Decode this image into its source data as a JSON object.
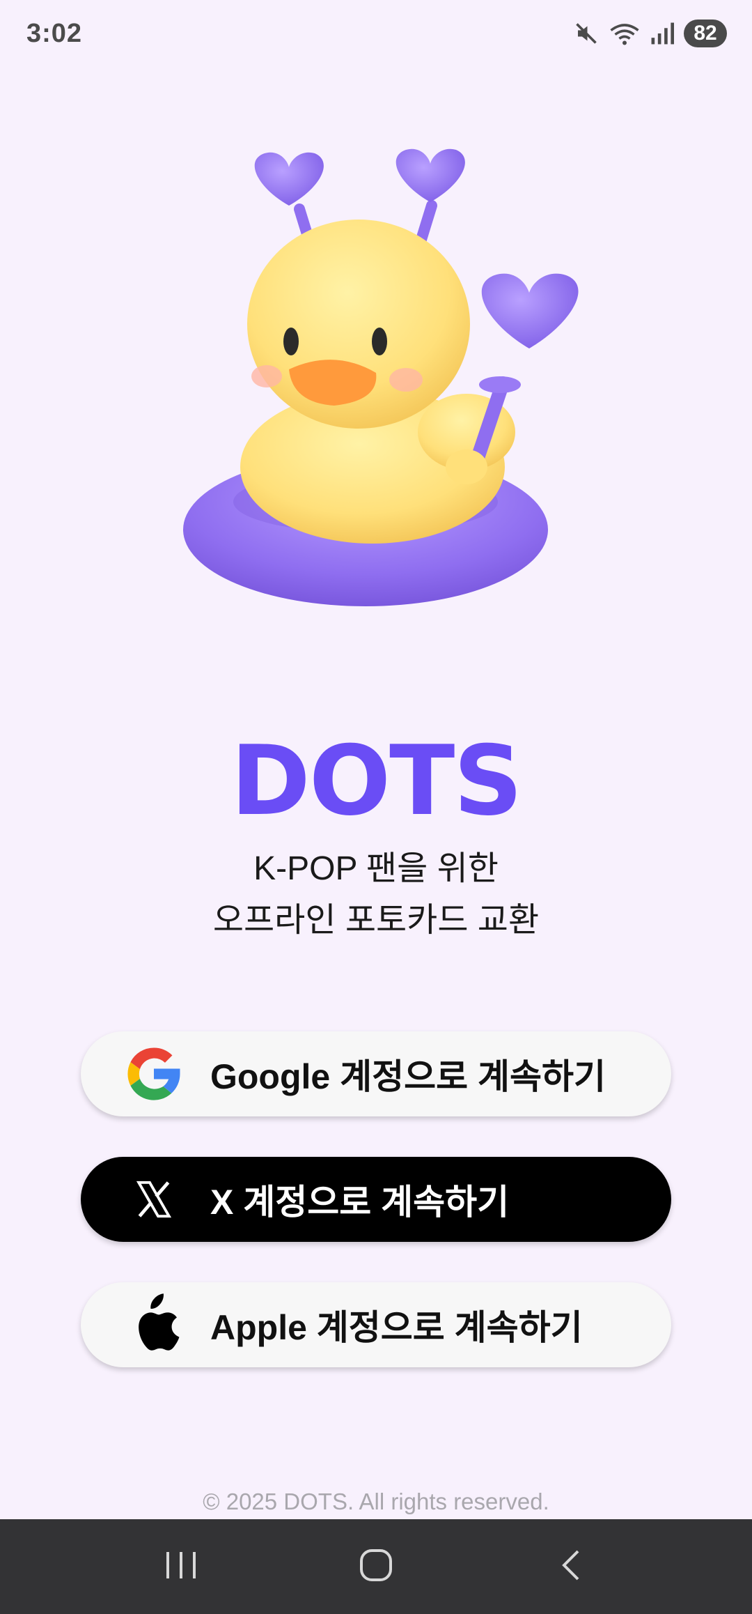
{
  "status_bar": {
    "time": "3:02",
    "battery": "82",
    "icons": [
      "mute-icon",
      "wifi-icon",
      "signal-icon"
    ]
  },
  "brand": {
    "name": "DOTS",
    "color": "#6a4df5",
    "tagline_line1": "K-POP 팬을 위한",
    "tagline_line2": "오프라인 포토카드 교환"
  },
  "login": {
    "google_label": "Google 계정으로 계속하기",
    "x_label": "X 계정으로 계속하기",
    "apple_label": "Apple 계정으로 계속하기"
  },
  "footer": {
    "copyright": "© 2025 DOTS. All rights reserved."
  },
  "nav": {
    "icons": [
      "recent-apps-icon",
      "home-icon",
      "back-icon"
    ]
  }
}
